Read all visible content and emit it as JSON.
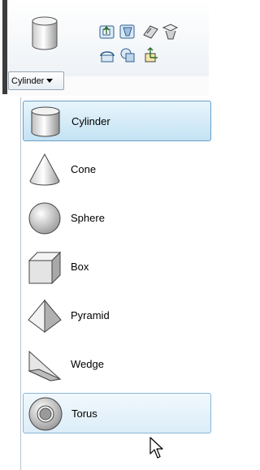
{
  "ribbon": {
    "primitive_button_label": "Cylinder",
    "tools": [
      "extrude-icon",
      "presspull-icon",
      "sweep-icon",
      "loft-icon",
      "revolve-icon",
      "union-icon",
      "moveaxis-icon"
    ]
  },
  "menu": {
    "items": [
      {
        "label": "Cylinder",
        "icon": "cylinder-icon"
      },
      {
        "label": "Cone",
        "icon": "cone-icon"
      },
      {
        "label": "Sphere",
        "icon": "sphere-icon"
      },
      {
        "label": "Box",
        "icon": "box-icon"
      },
      {
        "label": "Pyramid",
        "icon": "pyramid-icon"
      },
      {
        "label": "Wedge",
        "icon": "wedge-icon"
      },
      {
        "label": "Torus",
        "icon": "torus-icon"
      }
    ],
    "selected": "Cylinder",
    "hovered": "Torus"
  },
  "colors": {
    "selected_bg": "#c4e2f3",
    "selected_border": "#6aa0c8",
    "hover_border": "#8ab6d6"
  }
}
